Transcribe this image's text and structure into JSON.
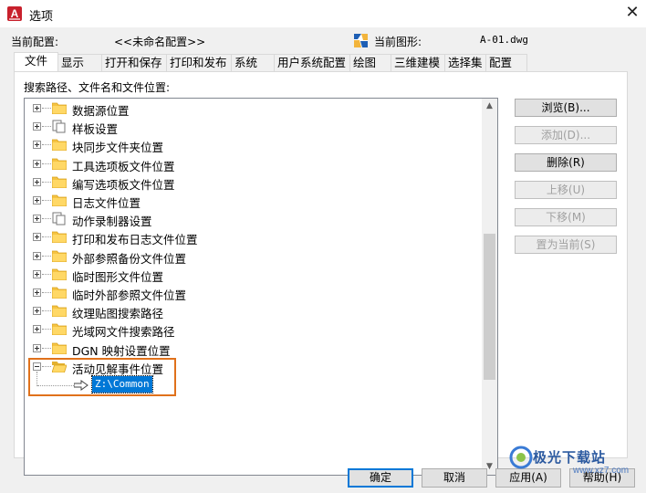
{
  "window": {
    "title": "选项",
    "app_icon_letter": "A",
    "close_glyph": "✕"
  },
  "config": {
    "current_profile_label": "当前配置:",
    "current_profile_value": "<<未命名配置>>",
    "current_drawing_label": "当前图形:",
    "current_drawing_value": "A-01.dwg"
  },
  "tabs": [
    {
      "label": "文件",
      "active": true
    },
    {
      "label": "显示"
    },
    {
      "label": "打开和保存"
    },
    {
      "label": "打印和发布"
    },
    {
      "label": "系统"
    },
    {
      "label": "用户系统配置"
    },
    {
      "label": "绘图"
    },
    {
      "label": "三维建模"
    },
    {
      "label": "选择集"
    },
    {
      "label": "配置"
    }
  ],
  "panel": {
    "label": "搜索路径、文件名和文件位置:"
  },
  "tree": {
    "items": [
      {
        "label": "数据源位置",
        "icon": "folder"
      },
      {
        "label": "样板设置",
        "icon": "documents"
      },
      {
        "label": "块同步文件夹位置",
        "icon": "folder"
      },
      {
        "label": "工具选项板文件位置",
        "icon": "folder"
      },
      {
        "label": "编写选项板文件位置",
        "icon": "folder"
      },
      {
        "label": "日志文件位置",
        "icon": "folder"
      },
      {
        "label": "动作录制器设置",
        "icon": "documents"
      },
      {
        "label": "打印和发布日志文件位置",
        "icon": "folder"
      },
      {
        "label": "外部参照备份文件位置",
        "icon": "folder"
      },
      {
        "label": "临时图形文件位置",
        "icon": "folder"
      },
      {
        "label": "临时外部参照文件位置",
        "icon": "folder"
      },
      {
        "label": "纹理贴图搜索路径",
        "icon": "folder"
      },
      {
        "label": "光域网文件搜索路径",
        "icon": "folder"
      },
      {
        "label": "DGN 映射设置位置",
        "icon": "folder"
      },
      {
        "label": "活动见解事件位置",
        "icon": "folder-open",
        "expanded": true
      }
    ],
    "child_value": "Z:\\Common",
    "scroll_up": "▲",
    "scroll_down": "▼"
  },
  "side_buttons": {
    "browse": "浏览(B)...",
    "add": "添加(D)...",
    "remove": "删除(R)",
    "move_up": "上移(U)",
    "move_down": "下移(M)",
    "set_current": "置为当前(S)"
  },
  "bottom_buttons": {
    "ok": "确定",
    "cancel": "取消",
    "apply": "应用(A)",
    "help": "帮助(H)"
  },
  "watermark": {
    "text": "极光下载站",
    "url": "www.xz7.com"
  },
  "colors": {
    "selection": "#0078d7",
    "highlight_box": "#e0711b",
    "folder": "#f5c342"
  }
}
